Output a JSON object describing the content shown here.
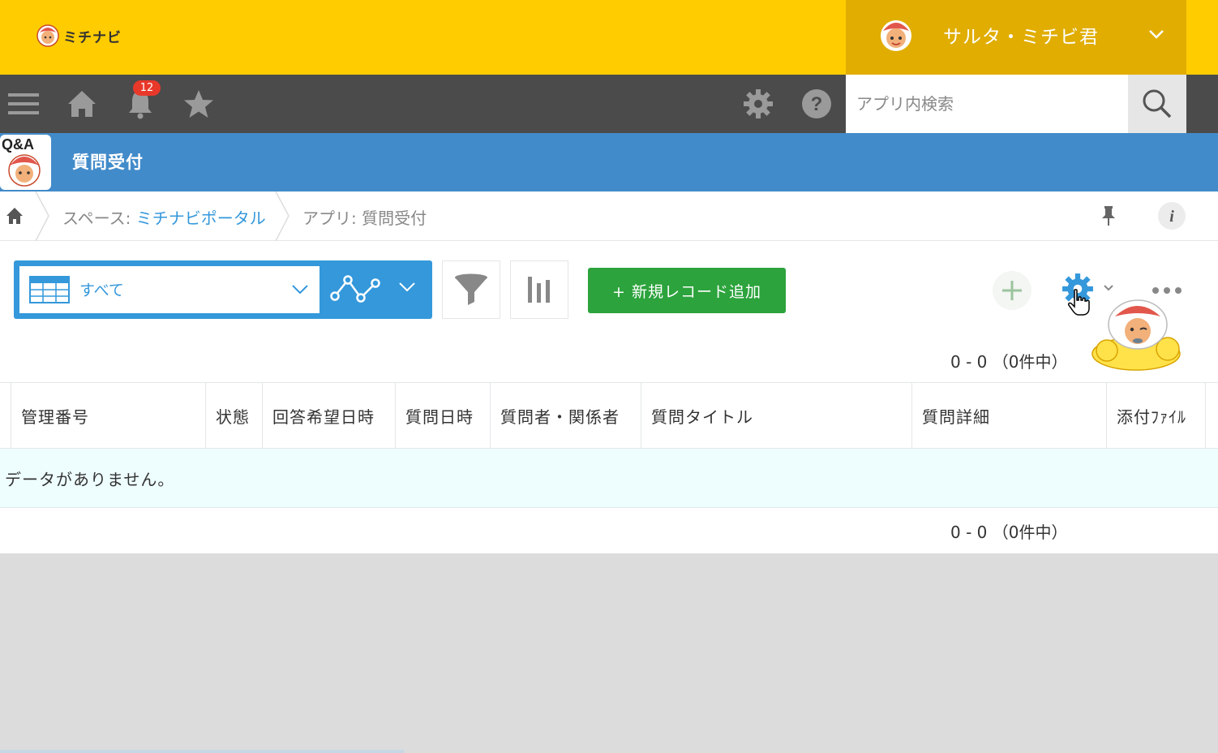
{
  "brand": {
    "name": "ミチナビ"
  },
  "user": {
    "name": "サルタ・ミチビ君"
  },
  "nav": {
    "notification_count": "12"
  },
  "search": {
    "placeholder": "アプリ内検索"
  },
  "app": {
    "icon_label": "Q&A",
    "title": "質問受付"
  },
  "breadcrumb": {
    "space_prefix": "スペース: ",
    "space_name": "ミチナビポータル",
    "app_label": "アプリ: 質問受付"
  },
  "toolbar": {
    "view_name": "すべて",
    "add_record_label": "+ 新規レコード追加"
  },
  "pager": {
    "top": "0 - 0 （0件中）",
    "bottom": "0 - 0 （0件中）"
  },
  "table": {
    "columns": [
      "管理番号",
      "状態",
      "回答希望日時",
      "質問日時",
      "質問者・関係者",
      "質問タイトル",
      "質問詳細",
      "添付ﾌｧｲﾙ"
    ],
    "empty_message": "データがありません。"
  },
  "icons": {
    "menu": "hamburger-icon",
    "home": "home-icon",
    "notifications": "bell-icon",
    "favorites": "star-icon",
    "settings": "gear-icon",
    "help": "help-icon",
    "search": "search-icon",
    "pin": "pin-icon",
    "info": "info-icon",
    "table_view": "table-icon",
    "graph": "graph-icon",
    "filter": "filter-icon",
    "chart": "bar-chart-icon",
    "add": "plus-icon",
    "app_settings": "gear-icon",
    "more": "more-dots-icon"
  },
  "colors": {
    "header_yellow": "#ffcc00",
    "user_box": "#e0ad00",
    "nav_dark": "#4b4b4b",
    "app_blue": "#428bca",
    "view_blue": "#3498db",
    "add_green": "#2ca33c",
    "badge_red": "#e8382a",
    "empty_row": "#eefeff"
  }
}
